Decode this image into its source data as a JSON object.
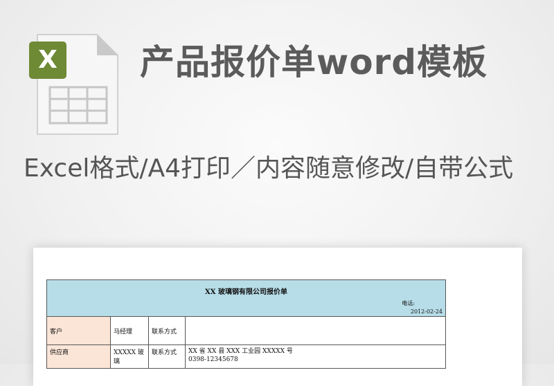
{
  "header": {
    "title": "产品报价单word模板",
    "subtitle": "Excel格式/A4打印／内容随意修改/自带公式"
  },
  "file_icon": {
    "glyph": "X",
    "badge_color": "#6e8a35",
    "icon": "excel-file-icon"
  },
  "document": {
    "title": "XX 玻璃钢有限公司报价单",
    "tel_label": "电话:",
    "date": "2012-02-24",
    "rows": [
      {
        "label": "客户",
        "value": "马经理",
        "label2": "联系方式",
        "value2": ""
      },
      {
        "label": "供应商",
        "value": "XXXXX 玻璃",
        "label2": "联系方式",
        "address": "XX 省 XX 县 XXX 工业园 XXXXX 号",
        "phone": "0398-12345678"
      }
    ]
  }
}
